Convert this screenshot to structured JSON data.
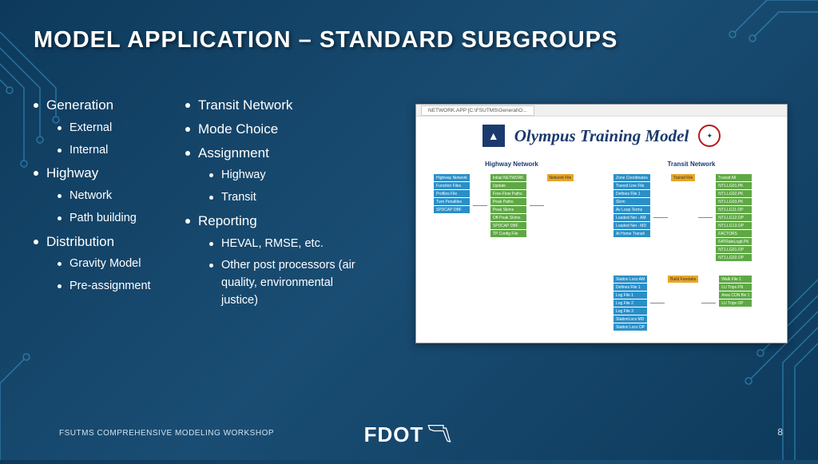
{
  "title": "MODEL APPLICATION – STANDARD SUBGROUPS",
  "col1": [
    {
      "l1": "Generation",
      "l2": [
        "External",
        "Internal"
      ]
    },
    {
      "l1": "Highway",
      "l2": [
        "Network",
        "Path building"
      ]
    },
    {
      "l1": "Distribution",
      "l2": [
        "Gravity Model",
        "Pre-assignment"
      ]
    }
  ],
  "col2": [
    {
      "l1": "Transit Network",
      "l2": []
    },
    {
      "l1": "Mode Choice",
      "l2": []
    },
    {
      "l1": "Assignment",
      "l2": [
        "Highway",
        "Transit"
      ]
    },
    {
      "l1": "Reporting",
      "l2": [
        "HEVAL, RMSE, etc.",
        "Other post processors (air quality, environmental justice)"
      ]
    }
  ],
  "screenshot": {
    "window_tab": "NETWORK.APP [C:\\FSUTMS\\General\\O...",
    "app_title": "Olympus Training Model",
    "heading_left": "Highway Network",
    "heading_right": "Transit Network",
    "hwy_left_stack": [
      "Highway Network",
      "Function Files",
      "Profiles File",
      "Turn Penalties",
      "SPDCAP DBF"
    ],
    "hwy_mid_green": [
      "Initial NETWORK",
      "Update",
      "Free-Flow Paths",
      "Peak Paths",
      "Peak Skims",
      "Off-Peak Skims",
      "SPDCAP DBF",
      "TP Config File"
    ],
    "hwy_yellow": "Network File",
    "trn_left_blue": [
      "Zone Coordinates",
      "Transit Line File",
      "Defines File 1",
      "Skrm",
      "Av Loop Terms",
      "Loaded Net - AM",
      "Loaded Net - MD",
      "At Home Transit"
    ],
    "trn_yellow": "Transit File",
    "trn_right_green": [
      "Transit All",
      "NT1.LG01.PK",
      "NT1.LG02.PK",
      "NT1.LG03.PK",
      "NT1.LG11.OP",
      "NT1.LG12.OP",
      "NT1.LG13.OP",
      "FACTORS",
      "FATRateLogit.PK",
      "NT1.LG01.OP",
      "NT1.LG02.OP"
    ],
    "bottom_blue": [
      "Station Locs AM",
      "Defines File 1",
      "Log File 1",
      "Log File 2",
      "Log File 3",
      "StationLocs MD",
      "Station Locs OP"
    ],
    "bottom_yellow": "Build Faretabs",
    "bottom_green": [
      "Walk File 1",
      "LU Trips FN",
      "Area CON file 1",
      "LU Trips OP"
    ]
  },
  "footer": "FSUTMS COMPREHENSIVE MODELING WORKSHOP",
  "page_number": "8",
  "logo_text": "FDOT"
}
